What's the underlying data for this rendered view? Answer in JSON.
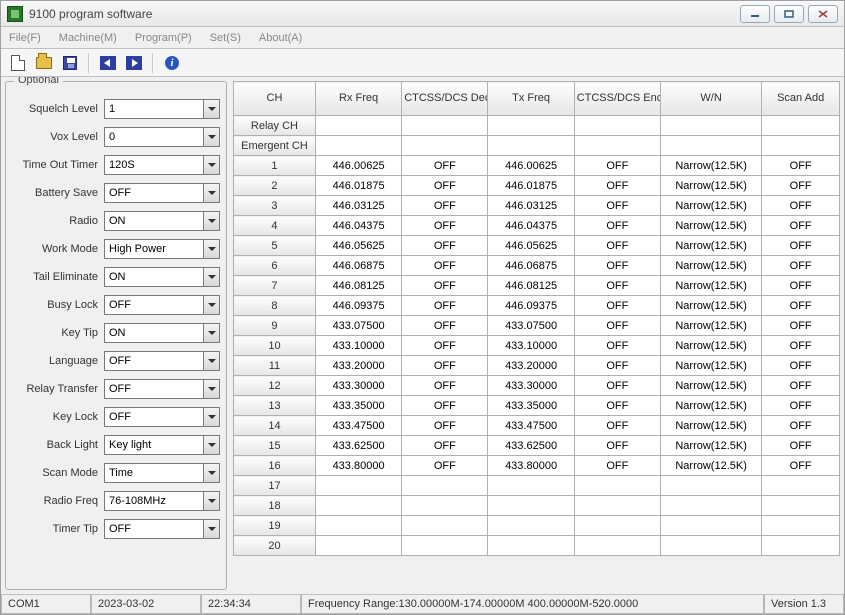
{
  "window": {
    "title": "9100 program software"
  },
  "menu": {
    "file": "File(F)",
    "machine": "Machine(M)",
    "program": "Program(P)",
    "set": "Set(S)",
    "about": "About(A)"
  },
  "info_glyph": "i",
  "optional": {
    "legend": "Optional",
    "fields": [
      {
        "label": "Squelch Level",
        "value": "1"
      },
      {
        "label": "Vox Level",
        "value": "0"
      },
      {
        "label": "Time Out Timer",
        "value": "120S"
      },
      {
        "label": "Battery Save",
        "value": "OFF"
      },
      {
        "label": "Radio",
        "value": "ON"
      },
      {
        "label": "Work Mode",
        "value": "High Power"
      },
      {
        "label": "Tail Eliminate",
        "value": "ON"
      },
      {
        "label": "Busy Lock",
        "value": "OFF"
      },
      {
        "label": "Key Tip",
        "value": "ON"
      },
      {
        "label": "Language",
        "value": "OFF"
      },
      {
        "label": "Relay Transfer",
        "value": "OFF"
      },
      {
        "label": "Key Lock",
        "value": "OFF"
      },
      {
        "label": "Back Light",
        "value": "Key light"
      },
      {
        "label": "Scan Mode",
        "value": "Time"
      },
      {
        "label": "Radio Freq",
        "value": "76-108MHz"
      },
      {
        "label": "Timer Tip",
        "value": "OFF"
      }
    ]
  },
  "table": {
    "headers": {
      "ch": "CH",
      "rx": "Rx Freq",
      "dec": "CTCSS/DCS Dec",
      "tx": "Tx Freq",
      "enc": "CTCSS/DCS Enc",
      "wn": "W/N",
      "scan": "Scan Add"
    },
    "special_rows": {
      "relay": "Relay CH",
      "emergent": "Emergent CH"
    },
    "rows": [
      {
        "ch": "1",
        "rx": "446.00625",
        "dec": "OFF",
        "tx": "446.00625",
        "enc": "OFF",
        "wn": "Narrow(12.5K)",
        "scan": "OFF"
      },
      {
        "ch": "2",
        "rx": "446.01875",
        "dec": "OFF",
        "tx": "446.01875",
        "enc": "OFF",
        "wn": "Narrow(12.5K)",
        "scan": "OFF"
      },
      {
        "ch": "3",
        "rx": "446.03125",
        "dec": "OFF",
        "tx": "446.03125",
        "enc": "OFF",
        "wn": "Narrow(12.5K)",
        "scan": "OFF"
      },
      {
        "ch": "4",
        "rx": "446.04375",
        "dec": "OFF",
        "tx": "446.04375",
        "enc": "OFF",
        "wn": "Narrow(12.5K)",
        "scan": "OFF"
      },
      {
        "ch": "5",
        "rx": "446.05625",
        "dec": "OFF",
        "tx": "446.05625",
        "enc": "OFF",
        "wn": "Narrow(12.5K)",
        "scan": "OFF"
      },
      {
        "ch": "6",
        "rx": "446.06875",
        "dec": "OFF",
        "tx": "446.06875",
        "enc": "OFF",
        "wn": "Narrow(12.5K)",
        "scan": "OFF"
      },
      {
        "ch": "7",
        "rx": "446.08125",
        "dec": "OFF",
        "tx": "446.08125",
        "enc": "OFF",
        "wn": "Narrow(12.5K)",
        "scan": "OFF"
      },
      {
        "ch": "8",
        "rx": "446.09375",
        "dec": "OFF",
        "tx": "446.09375",
        "enc": "OFF",
        "wn": "Narrow(12.5K)",
        "scan": "OFF"
      },
      {
        "ch": "9",
        "rx": "433.07500",
        "dec": "OFF",
        "tx": "433.07500",
        "enc": "OFF",
        "wn": "Narrow(12.5K)",
        "scan": "OFF"
      },
      {
        "ch": "10",
        "rx": "433.10000",
        "dec": "OFF",
        "tx": "433.10000",
        "enc": "OFF",
        "wn": "Narrow(12.5K)",
        "scan": "OFF"
      },
      {
        "ch": "11",
        "rx": "433.20000",
        "dec": "OFF",
        "tx": "433.20000",
        "enc": "OFF",
        "wn": "Narrow(12.5K)",
        "scan": "OFF"
      },
      {
        "ch": "12",
        "rx": "433.30000",
        "dec": "OFF",
        "tx": "433.30000",
        "enc": "OFF",
        "wn": "Narrow(12.5K)",
        "scan": "OFF"
      },
      {
        "ch": "13",
        "rx": "433.35000",
        "dec": "OFF",
        "tx": "433.35000",
        "enc": "OFF",
        "wn": "Narrow(12.5K)",
        "scan": "OFF"
      },
      {
        "ch": "14",
        "rx": "433.47500",
        "dec": "OFF",
        "tx": "433.47500",
        "enc": "OFF",
        "wn": "Narrow(12.5K)",
        "scan": "OFF"
      },
      {
        "ch": "15",
        "rx": "433.62500",
        "dec": "OFF",
        "tx": "433.62500",
        "enc": "OFF",
        "wn": "Narrow(12.5K)",
        "scan": "OFF"
      },
      {
        "ch": "16",
        "rx": "433.80000",
        "dec": "OFF",
        "tx": "433.80000",
        "enc": "OFF",
        "wn": "Narrow(12.5K)",
        "scan": "OFF"
      },
      {
        "ch": "17",
        "rx": "",
        "dec": "",
        "tx": "",
        "enc": "",
        "wn": "",
        "scan": ""
      },
      {
        "ch": "18",
        "rx": "",
        "dec": "",
        "tx": "",
        "enc": "",
        "wn": "",
        "scan": ""
      },
      {
        "ch": "19",
        "rx": "",
        "dec": "",
        "tx": "",
        "enc": "",
        "wn": "",
        "scan": ""
      },
      {
        "ch": "20",
        "rx": "",
        "dec": "",
        "tx": "",
        "enc": "",
        "wn": "",
        "scan": ""
      }
    ]
  },
  "status": {
    "port": "COM1",
    "date": "2023-03-02",
    "time": "22:34:34",
    "freq": "Frequency Range:130.00000M-174.00000M    400.00000M-520.0000",
    "version": "Version 1.3"
  }
}
